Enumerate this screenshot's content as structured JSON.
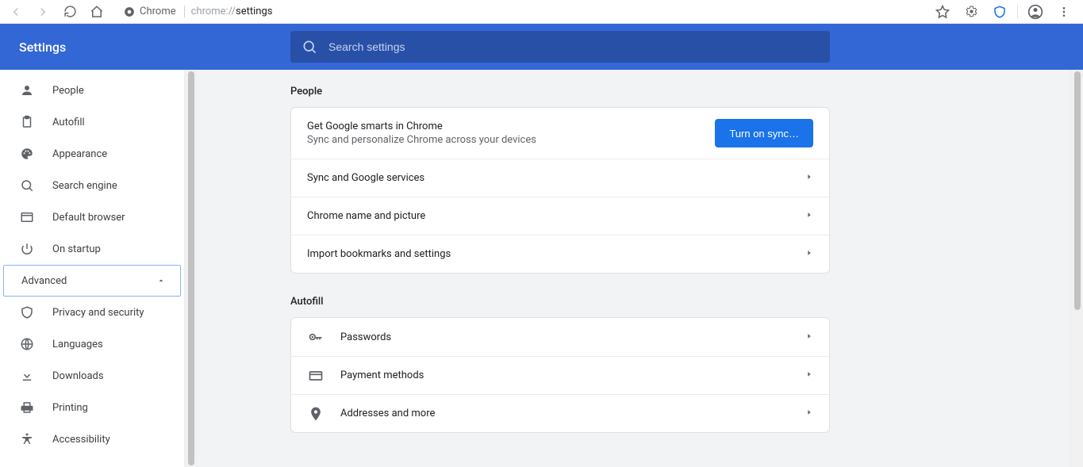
{
  "toolbar": {
    "site_label": "Chrome",
    "url_prefix": "chrome://",
    "url_path": "settings"
  },
  "header": {
    "title": "Settings",
    "search_placeholder": "Search settings"
  },
  "sidebar": {
    "items": [
      {
        "label": "People"
      },
      {
        "label": "Autofill"
      },
      {
        "label": "Appearance"
      },
      {
        "label": "Search engine"
      },
      {
        "label": "Default browser"
      },
      {
        "label": "On startup"
      }
    ],
    "advanced_label": "Advanced",
    "adv_items": [
      {
        "label": "Privacy and security"
      },
      {
        "label": "Languages"
      },
      {
        "label": "Downloads"
      },
      {
        "label": "Printing"
      },
      {
        "label": "Accessibility"
      }
    ]
  },
  "sections": {
    "people": {
      "title": "People",
      "sync_title": "Get Google smarts in Chrome",
      "sync_sub": "Sync and personalize Chrome across your devices",
      "sync_button": "Turn on sync…",
      "rows": [
        "Sync and Google services",
        "Chrome name and picture",
        "Import bookmarks and settings"
      ]
    },
    "autofill": {
      "title": "Autofill",
      "rows": [
        "Passwords",
        "Payment methods",
        "Addresses and more"
      ]
    }
  }
}
